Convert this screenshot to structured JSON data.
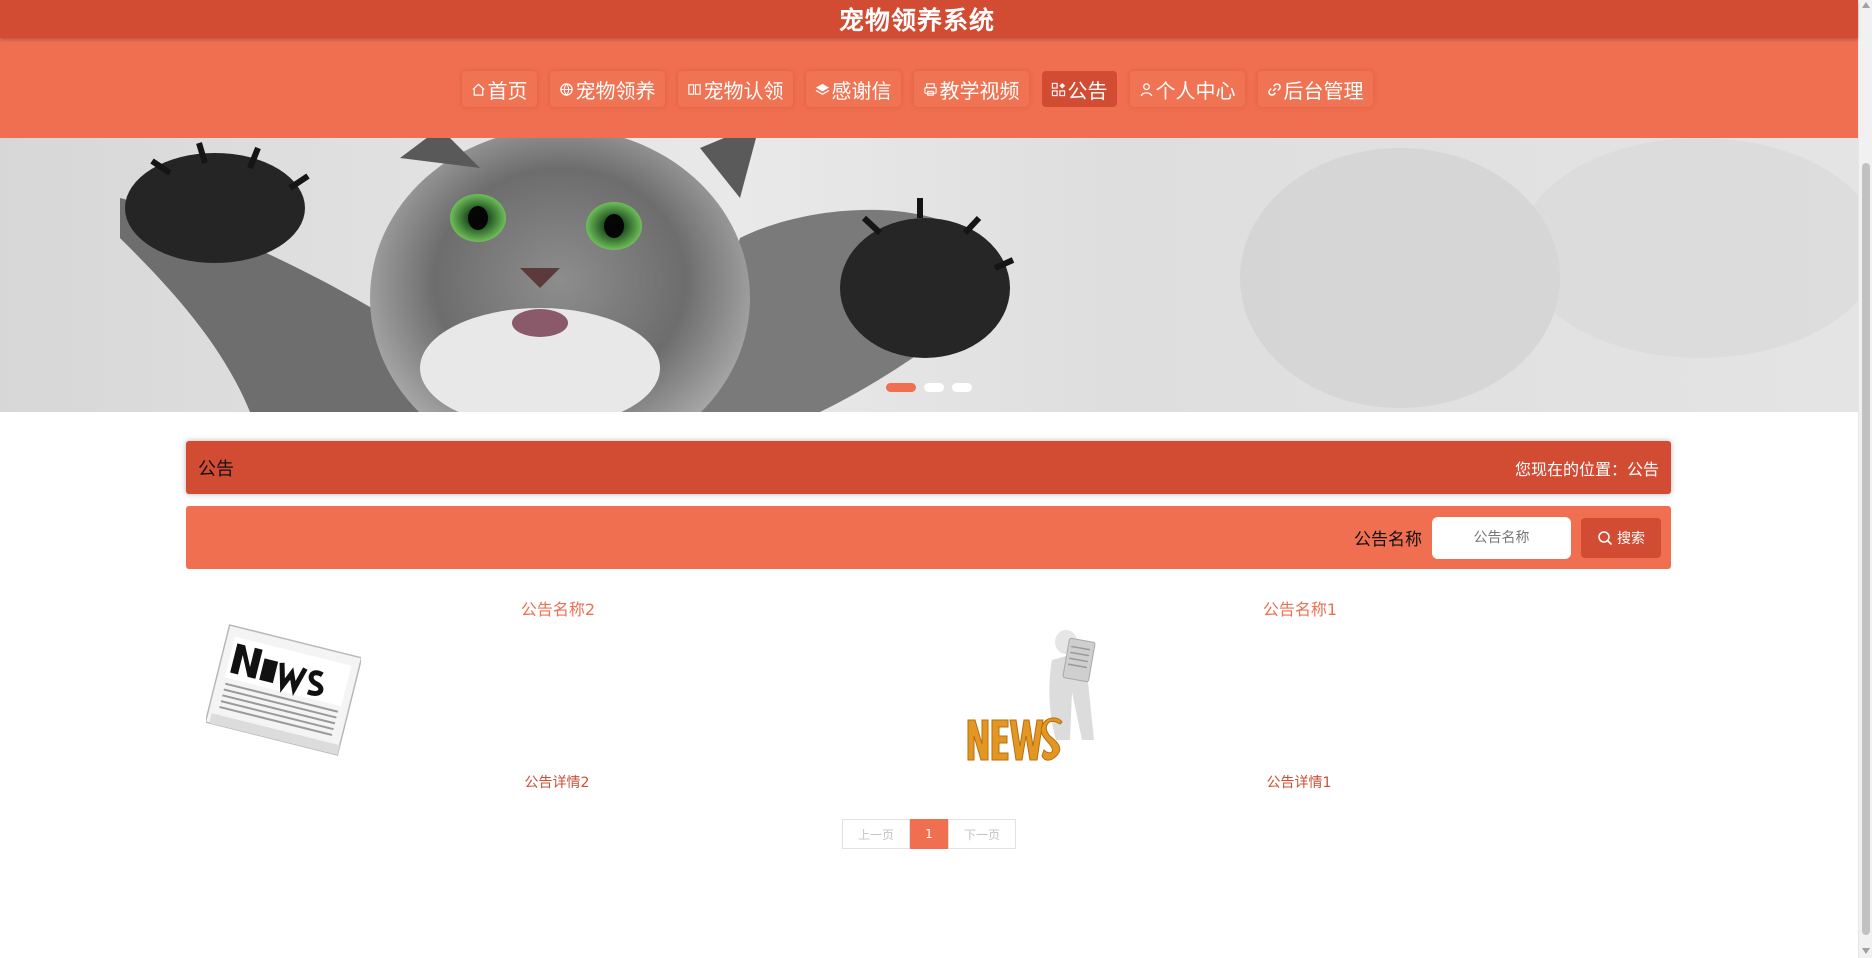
{
  "header": {
    "title": "宠物领养系统"
  },
  "nav": {
    "items": [
      {
        "label": "首页",
        "icon": "home-icon",
        "active": false
      },
      {
        "label": "宠物领养",
        "icon": "globe-icon",
        "active": false
      },
      {
        "label": "宠物认领",
        "icon": "book-icon",
        "active": false
      },
      {
        "label": "感谢信",
        "icon": "layers-icon",
        "active": false
      },
      {
        "label": "教学视频",
        "icon": "printer-icon",
        "active": false
      },
      {
        "label": "公告",
        "icon": "apps-icon",
        "active": true
      },
      {
        "label": "个人中心",
        "icon": "user-icon",
        "active": false
      },
      {
        "label": "后台管理",
        "icon": "link-icon",
        "active": false
      }
    ]
  },
  "banner": {
    "slides": 3,
    "active_slide": 1
  },
  "breadcrumb": {
    "title": "公告",
    "position": "您现在的位置：公告"
  },
  "search": {
    "label": "公告名称",
    "placeholder": "公告名称",
    "button_label": "搜索"
  },
  "notices": [
    {
      "name": "公告名称2",
      "detail": "公告详情2",
      "image": "newspaper-image"
    },
    {
      "name": "公告名称1",
      "detail": "公告详情1",
      "image": "news-reader-image"
    }
  ],
  "pagination": {
    "prev": "上一页",
    "current": "1",
    "next": "下一页"
  },
  "colors": {
    "primary": "#d24b33",
    "accent": "#ef6f50"
  }
}
